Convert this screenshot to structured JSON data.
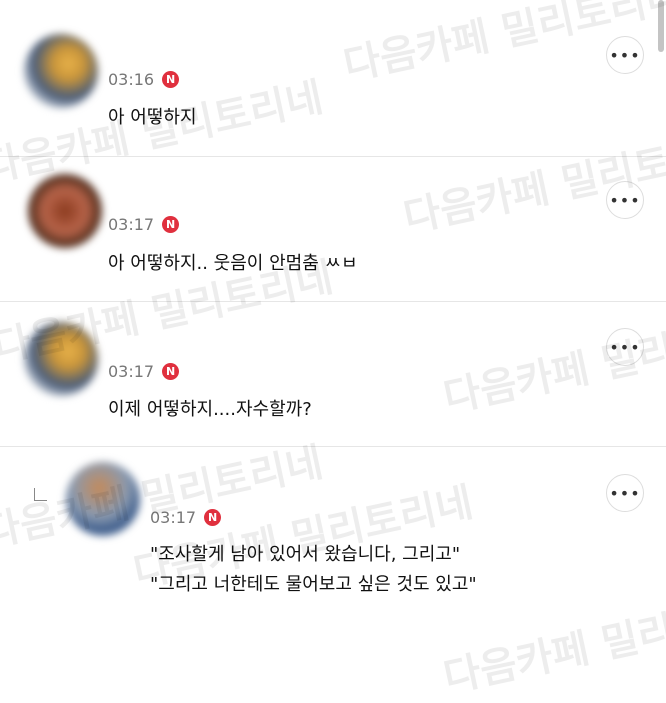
{
  "watermark": {
    "text": "다음카페 밀리토리네"
  },
  "comments": [
    {
      "time": "03:16",
      "badge": "N",
      "lines": [
        "아 어떻하지"
      ]
    },
    {
      "time": "03:17",
      "badge": "N",
      "lines": [
        "아 어떻하지.. 웃음이 안멈춤 ㅆㅂ"
      ]
    },
    {
      "time": "03:17",
      "badge": "N",
      "lines": [
        "이제 어떻하지....자수할까?"
      ]
    },
    {
      "time": "03:17",
      "badge": "N",
      "lines": [
        "\"조사할게 남아 있어서 왔습니다, 그리고\"",
        "\"그리고 너한테도 물어보고 싶은 것도 있고\""
      ]
    }
  ],
  "more_label": "•••",
  "icons": {
    "reply": "reply-arrow-icon",
    "more": "more-options-icon",
    "new": "new-badge-icon"
  }
}
